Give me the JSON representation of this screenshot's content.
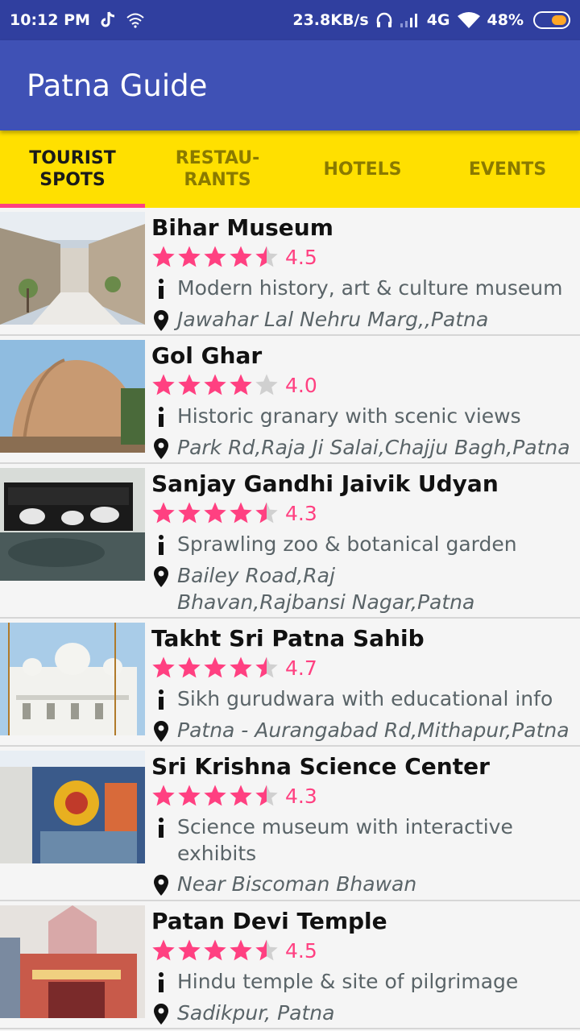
{
  "status_bar": {
    "time": "10:12 PM",
    "network_speed": "23.8KB/s",
    "network_type": "4G",
    "battery": "48%",
    "icons": [
      "tiktok-icon",
      "wifi-icon",
      "headset-icon",
      "signal-icon",
      "wifi-icon",
      "battery-icon"
    ]
  },
  "app_bar": {
    "title": "Patna Guide"
  },
  "tabs": [
    {
      "label": "TOURIST\nSPOTS",
      "selected": true
    },
    {
      "label": "RESTAU-\nRANTS",
      "selected": false
    },
    {
      "label": "HOTELS",
      "selected": false
    },
    {
      "label": "EVENTS",
      "selected": false
    }
  ],
  "colors": {
    "primary": "#3f51b5",
    "primary_dark": "#303f9f",
    "tab_background": "#ffe000",
    "accent": "#ff4081"
  },
  "places": [
    {
      "name": "Bihar Museum",
      "rating": 4.5,
      "rating_label": "4.5",
      "description": "Modern history, art & culture museum",
      "address": "Jawahar Lal Nehru Marg,,Patna"
    },
    {
      "name": "Gol Ghar",
      "rating": 4.0,
      "rating_label": "4.0",
      "description": "Historic granary with scenic views",
      "address": "Park Rd,Raja Ji Salai,Chajju Bagh,Patna"
    },
    {
      "name": "Sanjay Gandhi Jaivik Udyan",
      "rating": 4.3,
      "rating_label": "4.3",
      "description": "Sprawling zoo & botanical garden",
      "address": "Bailey Road,Raj Bhavan,Rajbansi Nagar,Patna"
    },
    {
      "name": "Takht Sri Patna Sahib",
      "rating": 4.7,
      "rating_label": "4.7",
      "description": "Sikh gurudwara with educational info",
      "address": "Patna - Aurangabad Rd,Mithapur,Patna"
    },
    {
      "name": "Sri Krishna Science Center",
      "rating": 4.3,
      "rating_label": "4.3",
      "description": "Science museum with interactive exhibits",
      "address": "Near Biscoman Bhawan"
    },
    {
      "name": "Patan Devi Temple",
      "rating": 4.5,
      "rating_label": "4.5",
      "description": "Hindu temple & site of pilgrimage",
      "address": "Sadikpur, Patna"
    }
  ]
}
